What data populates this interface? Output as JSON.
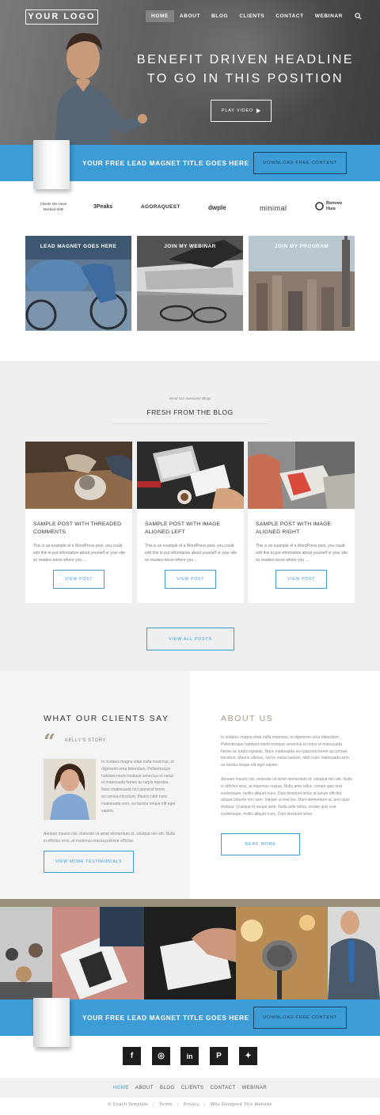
{
  "header": {
    "logo": "YOUR LOGO",
    "nav": [
      "HOME",
      "ABOUT",
      "BLOG",
      "CLIENTS",
      "CONTACT",
      "WEBINAR"
    ],
    "active_nav": "HOME",
    "search_icon": "search-icon"
  },
  "hero": {
    "headline_line1": "BENEFIT DRIVEN HEADLINE",
    "headline_line2": "TO GO IN THIS POSITION",
    "play_label": "PLAY VIDEO"
  },
  "lead_band": {
    "title": "YOUR FREE LEAD MAGNET TITLE GOES HERE",
    "button": "DOWNLOAD FREE CONTENT"
  },
  "clients": {
    "label": "Clients We Have Worked With",
    "logos": [
      "3Peaks",
      "AGORAQUEST",
      "dwple",
      "minimal",
      "Renovo Huis"
    ]
  },
  "promos": [
    {
      "title": "LEAD MAGNET GOES HERE"
    },
    {
      "title": "JOIN MY WEBINAR"
    },
    {
      "title": "JOIN MY PROGRAM"
    }
  ],
  "blog": {
    "kicker": "Read Our Awesome Blogs",
    "title": "FRESH FROM THE BLOG",
    "posts": [
      {
        "title": "SAMPLE POST WITH THREADED COMMENTS",
        "excerpt": "This is an example of a WordPress post, you could edit this to put information about yourself or your site so readers know where you ...",
        "button": "VIEW POST"
      },
      {
        "title": "SAMPLE POST WITH IMAGE ALIGNED LEFT",
        "excerpt": "This is an example of a WordPress post, you could edit this to put information about yourself or your site so readers know where you ...",
        "button": "VIEW POST"
      },
      {
        "title": "SAMPLE POST WITH IMAGE ALIGNED RIGHT",
        "excerpt": "This is an example of a WordPress post, you could edit this to put information about yourself or your site so readers know where you ...",
        "button": "VIEW POST"
      }
    ],
    "view_all": "VIEW ALL POSTS"
  },
  "testimonials": {
    "title": "WHAT OUR CLIENTS SAY",
    "name": "KELLY'S STORY",
    "side_text": "In sodales magna vitae nulla maximus, et dignissim urna bibendum. Pellentesque habitant morbi tristique senectus et netus et malesuada fames ac turpis egestas. Nunc malesuada orci placerat lorem accumsan tincidunt. Mauris nibh nunc malesuada sem, eu lacinia neque elit eget sapien.",
    "tail_text": "Aenean mauris nisl, molestie sit amet elementum id, volutpat nec elit. Nulla in efficitur eros, at maximus massa pulvinar efficitur.",
    "button": "VIEW MORE TESTIMONIALS"
  },
  "about": {
    "title": "ABOUT US",
    "p1": "In sodales magna vitae nulla maximus, et dignissim urna bibendum. Pellentesque habitant morbi tristique senectus et netus et malesuada fames ac turpis egestas. Nunc malesuada orci placerat lorem accumsan tincidunt. Mauris ultrices, nisl in varius laoreet, nibh nunc malesuada sem, eu lacinia neque elit eget sapien.",
    "p2": "Aenean mauris nisl, molestie sit amet elementum id, volutpat nec elit. Nulla in efficitur eros, at maximus massa. Nulla ante tellus, ornare quis erat scelerisque, mollis aliquet nunc. Duis tincidunt tellus at ipsum efficitur aliquet lobortis non sem. Integer ut erat leo. Nam elementum ac arcu quis tempus. Quisque id neque ante. Nulla ante tellus, ornare quis erat scelerisque, mollis aliquet nunc. Duis tincidunt tellus.",
    "button": "READ MORE"
  },
  "lead_band_bottom": {
    "title": "YOUR FREE LEAD MAGNET TITLE GOES HERE",
    "button": "DOWNLOAD FREE CONTENT"
  },
  "social": [
    {
      "icon": "facebook-icon",
      "glyph": "f"
    },
    {
      "icon": "instagram-icon",
      "glyph": "◎"
    },
    {
      "icon": "linkedin-icon",
      "glyph": "in"
    },
    {
      "icon": "pinterest-icon",
      "glyph": "P"
    },
    {
      "icon": "twitter-icon",
      "glyph": "✦"
    }
  ],
  "footer": {
    "nav": [
      "HOME",
      "ABOUT",
      "BLOG",
      "CLIENTS",
      "CONTACT",
      "WEBINAR"
    ],
    "copyright": "© Coach Template",
    "terms": "Terms",
    "privacy": "Privacy",
    "credit": "Who Designed This Website"
  },
  "colors": {
    "accent": "#3d9bd6",
    "tan": "#978f78",
    "dark": "#1d1d1d"
  }
}
